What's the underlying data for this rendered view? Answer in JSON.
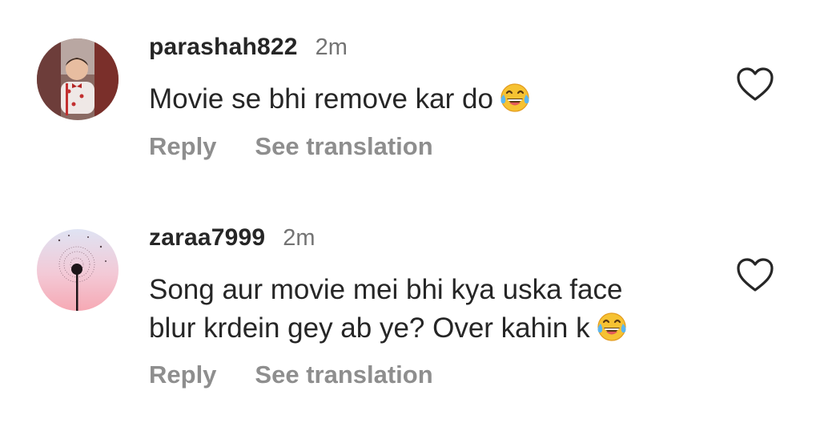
{
  "comments": [
    {
      "username": "parashah822",
      "time": "2m",
      "text": "Movie se bhi remove kar do",
      "emoji": "face-with-tears-of-joy-emoji",
      "reply_label": "Reply",
      "translate_label": "See translation",
      "like_icon": "heart-outline-icon"
    },
    {
      "username": "zaraa7999",
      "time": "2m",
      "text": "Song aur movie mei bhi kya uska face\nblur krdein gey ab ye? Over kahin k",
      "emoji": "face-with-tears-of-joy-emoji",
      "reply_label": "Reply",
      "translate_label": "See translation",
      "like_icon": "heart-outline-icon"
    }
  ],
  "colors": {
    "text_primary": "#262626",
    "text_secondary": "#737373",
    "action_text": "#8e8e8e"
  }
}
